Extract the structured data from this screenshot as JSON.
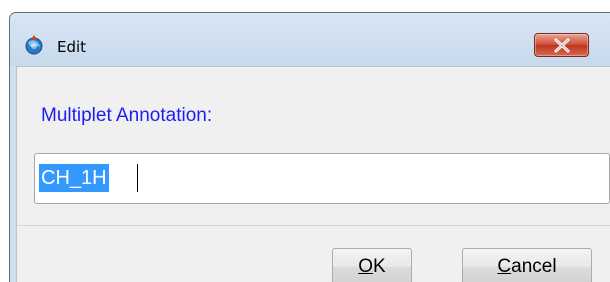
{
  "window": {
    "title": "Edit",
    "icon": "app-globe-icon",
    "close_icon": "close-x-icon",
    "accent_color": "#1e1ef0",
    "close_color": "#c94a35"
  },
  "form": {
    "label": "Multiplet Annotation:",
    "value": "CH_1H"
  },
  "buttons": {
    "ok": {
      "mnemonic": "O",
      "rest": "K"
    },
    "cancel": {
      "mnemonic": "C",
      "rest": "ancel"
    }
  }
}
